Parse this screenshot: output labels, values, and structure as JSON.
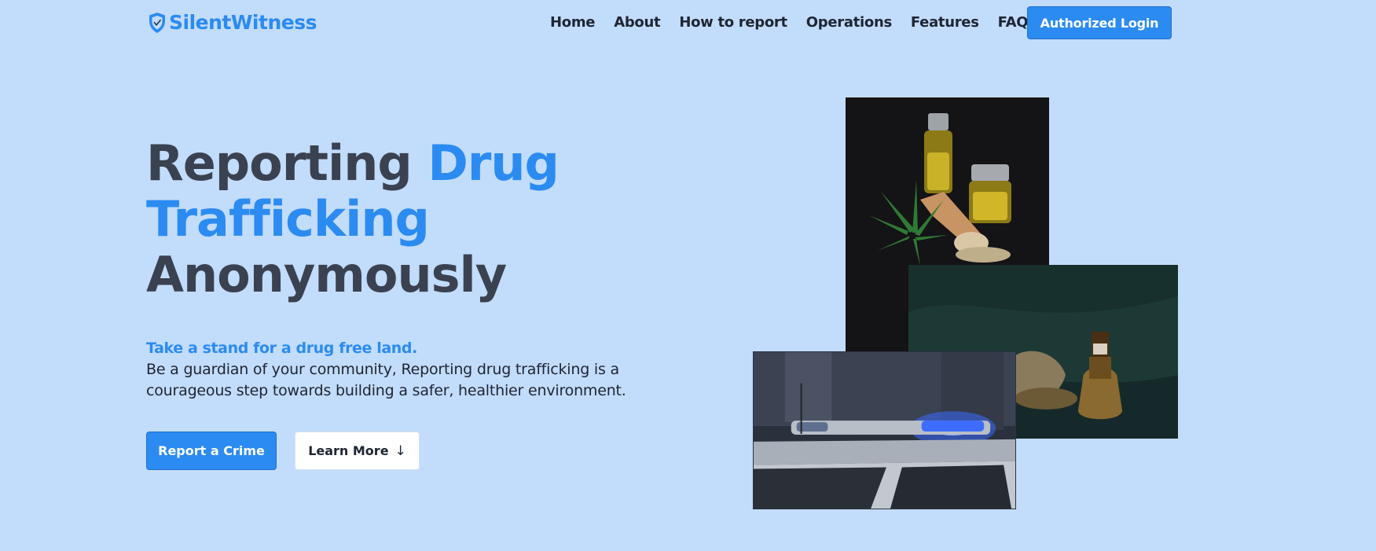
{
  "header": {
    "brand": "SilentWitness",
    "nav": [
      {
        "label": "Home"
      },
      {
        "label": "About"
      },
      {
        "label": "How to report"
      },
      {
        "label": "Operations"
      },
      {
        "label": "Features"
      },
      {
        "label": "FAQs"
      }
    ],
    "login_label": "Authorized Login"
  },
  "hero": {
    "title_part1": "Reporting ",
    "title_highlight": "Drug Trafficking",
    "title_part2": "Anonymously",
    "tagline": "Take a stand for a drug free land.",
    "description": "Be a guardian of your community, Reporting drug trafficking is a courageous step towards building a safer, healthier environment.",
    "primary_button": "Report a Crime",
    "secondary_button": "Learn More",
    "secondary_icon": "↓"
  },
  "images": [
    {
      "name": "cannabis-oil-photo"
    },
    {
      "name": "bottle-dark-cloth-photo"
    },
    {
      "name": "police-car-lights-photo"
    }
  ],
  "colors": {
    "background": "#c2dcfb",
    "accent": "#2b8bf0",
    "heading": "#3a4150",
    "text": "#1e2533"
  }
}
